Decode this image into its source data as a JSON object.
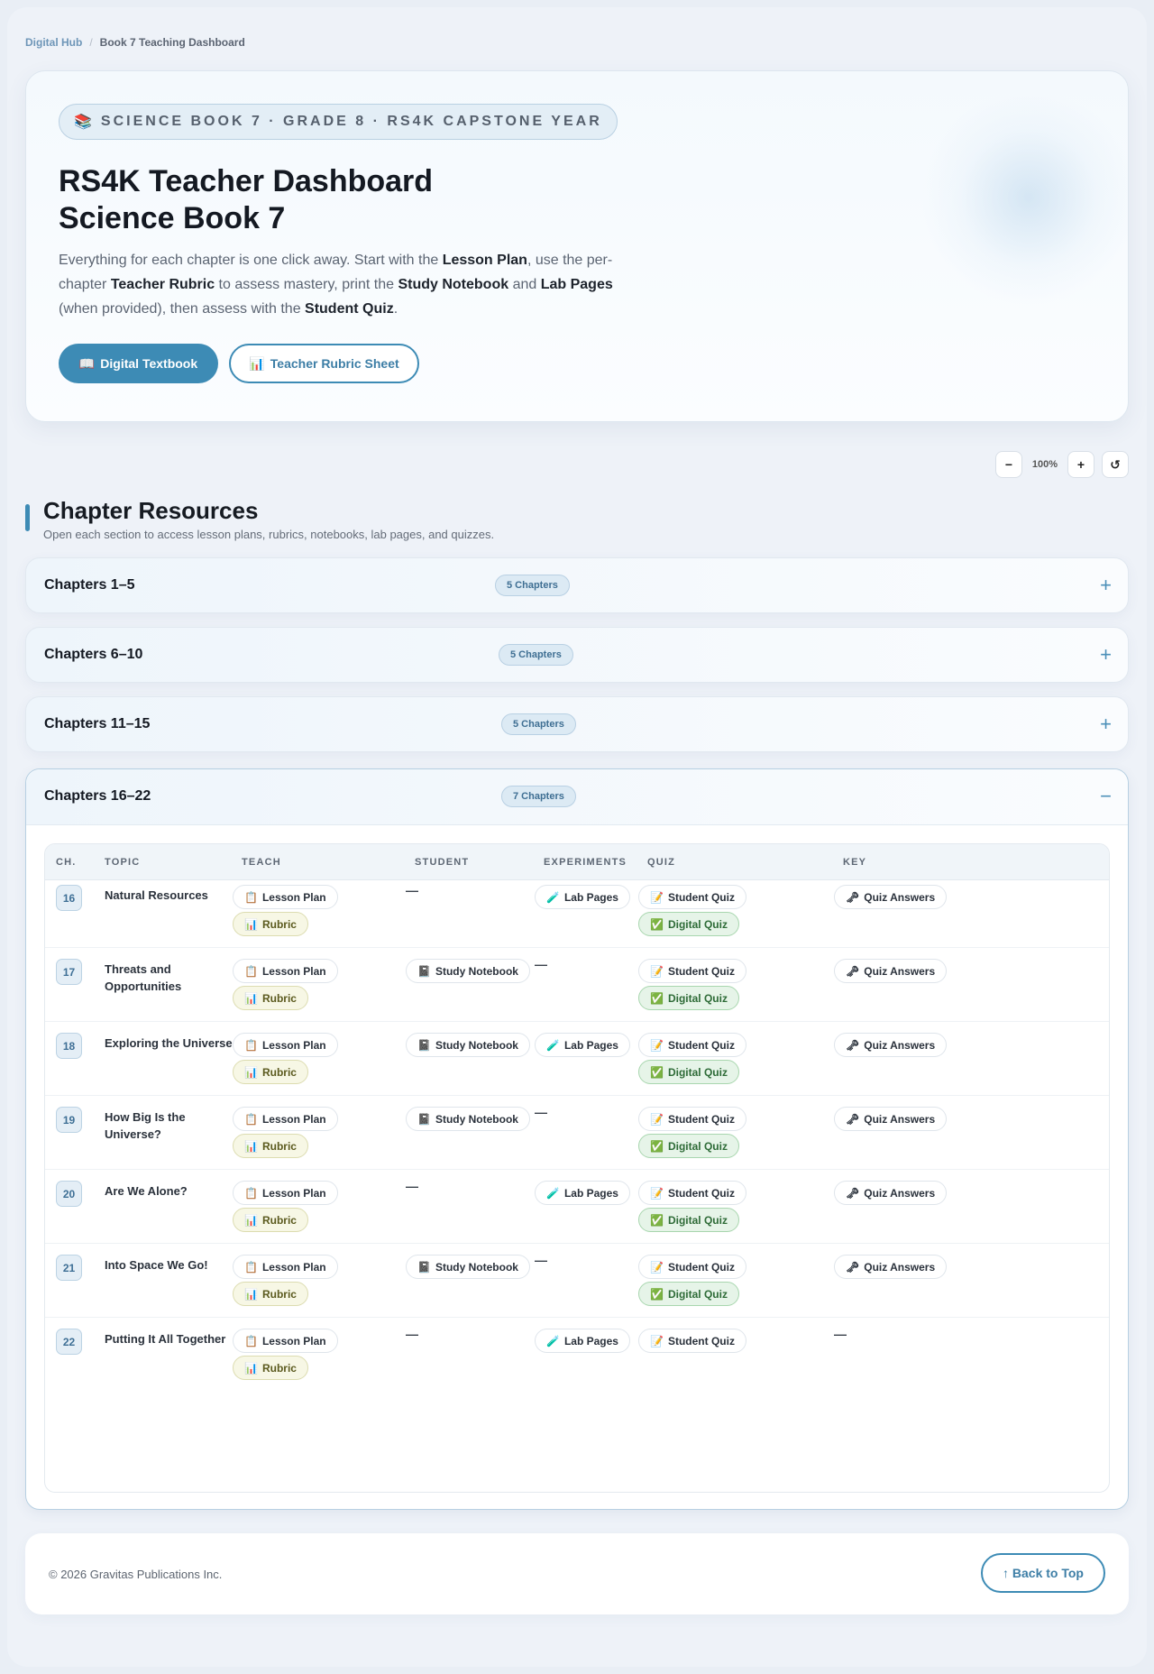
{
  "breadcrumb": {
    "home": "Digital Hub",
    "sep": "/",
    "current": "Book 7 Teaching Dashboard"
  },
  "hero": {
    "eyebrow_icon": "📚",
    "eyebrow": "SCIENCE BOOK 7 · GRADE 8 · RS4K CAPSTONE YEAR",
    "title_line1": "RS4K Teacher Dashboard",
    "title_line2": "Science Book 7",
    "desc": {
      "t1": "Everything for each chapter is one click away. Start with the ",
      "b1": "Lesson Plan",
      "t2": ", use the per-chapter ",
      "b2": "Teacher Rubric",
      "t3": " to assess mastery, print the ",
      "b3": "Study Notebook",
      "t4": " and ",
      "b4": "Lab Pages",
      "t5": " (when provided), then assess with the ",
      "b5": "Student Quiz",
      "t6": "."
    },
    "btn_primary_icon": "📖",
    "btn_primary": "Digital Textbook",
    "btn_outline_icon": "📊",
    "btn_outline": "Teacher Rubric Sheet"
  },
  "zoom": {
    "minus": "−",
    "value": "100%",
    "plus": "+",
    "reset": "↺"
  },
  "section": {
    "title": "Chapter Resources",
    "subtitle": "Open each section to access lesson plans, rubrics, notebooks, lab pages, and quizzes."
  },
  "accordions": [
    {
      "title": "Chapters 1–5",
      "badge": "5 Chapters",
      "toggle": "+"
    },
    {
      "title": "Chapters 6–10",
      "badge": "5 Chapters",
      "toggle": "+"
    },
    {
      "title": "Chapters 11–15",
      "badge": "5 Chapters",
      "toggle": "+"
    },
    {
      "title": "Chapters 16–22",
      "badge": "7 Chapters",
      "toggle": "−"
    }
  ],
  "table": {
    "headers": [
      "CH.",
      "TOPIC",
      "TEACH",
      "STUDENT",
      "EXPERIMENTS",
      "QUIZ",
      "KEY"
    ],
    "labels": {
      "lesson_plan": "Lesson Plan",
      "rubric": "Rubric",
      "study_notebook": "Study Notebook",
      "lab_pages": "Lab Pages",
      "student_quiz": "Student Quiz",
      "digital_quiz": "Digital Quiz",
      "quiz_answers": "Quiz Answers",
      "dash": "—"
    },
    "icons": {
      "lesson_plan": "📋",
      "rubric": "📊",
      "study_notebook": "📓",
      "lab_pages": "🧪",
      "student_quiz": "📝",
      "digital_quiz": "✅",
      "quiz_answers": "🗝"
    },
    "rows": [
      {
        "ch": "16",
        "topic": "Natural Resources",
        "notebook": false,
        "lab": true,
        "digital": true,
        "answers": true
      },
      {
        "ch": "17",
        "topic": "Threats and Opportunities",
        "notebook": true,
        "lab": false,
        "digital": true,
        "answers": true
      },
      {
        "ch": "18",
        "topic": "Exploring the Universe",
        "notebook": true,
        "lab": true,
        "digital": true,
        "answers": true
      },
      {
        "ch": "19",
        "topic": "How Big Is the Universe?",
        "notebook": true,
        "lab": false,
        "digital": true,
        "answers": true
      },
      {
        "ch": "20",
        "topic": "Are We Alone?",
        "notebook": false,
        "lab": true,
        "digital": true,
        "answers": true
      },
      {
        "ch": "21",
        "topic": "Into Space We Go!",
        "notebook": true,
        "lab": false,
        "digital": true,
        "answers": true
      },
      {
        "ch": "22",
        "topic": "Putting It All Together",
        "notebook": false,
        "lab": true,
        "digital": false,
        "answers": false
      }
    ]
  },
  "footer": {
    "copyright": "© 2026 Gravitas Publications Inc.",
    "back_to_top": "↑ Back to Top"
  }
}
